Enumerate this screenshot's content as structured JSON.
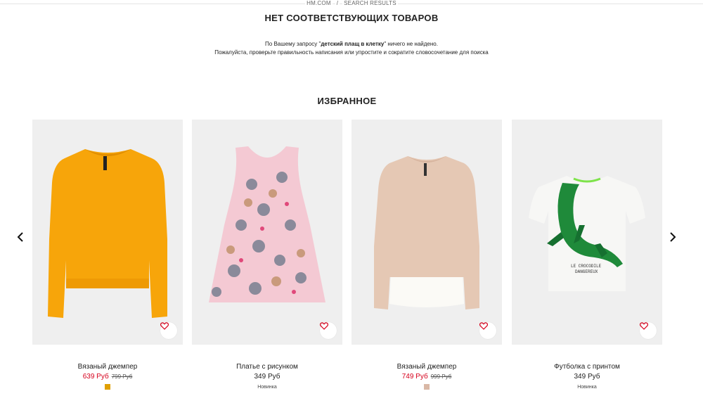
{
  "breadcrumb": {
    "home": "HM.COM",
    "separator": "/",
    "current": "SEARCH RESULTS"
  },
  "page_title": "НЕТ СООТВЕТСТВУЮЩИХ ТОВАРОВ",
  "message": {
    "prefix": "По Вашему запросу \"",
    "query": "детский плащ в клетку",
    "suffix": "\" ничего не найдено.",
    "line2": "Пожалуйста, проверьте правильность написания или упростите и сократите словосочетание для поиска"
  },
  "favorites_title": "ИЗБРАННОЕ",
  "icons": {
    "prev": "chevron-left-icon",
    "next": "chevron-right-icon",
    "favorite": "heart-icon"
  },
  "products": [
    {
      "name": "Вязаный джемпер",
      "price": "639 Руб",
      "old_price": "799 Руб",
      "on_sale": true,
      "swatch_color": "#e0a000",
      "badge": ""
    },
    {
      "name": "Платье с рисунком",
      "price": "349 Руб",
      "old_price": "",
      "on_sale": false,
      "swatch_color": "",
      "badge": "Новинка"
    },
    {
      "name": "Вязаный джемпер",
      "price": "749 Руб",
      "old_price": "999 Руб",
      "on_sale": true,
      "swatch_color": "#d9b8a6",
      "badge": ""
    },
    {
      "name": "Футболка с принтом",
      "price": "349 Руб",
      "old_price": "",
      "on_sale": false,
      "swatch_color": "",
      "badge": "Новинка"
    }
  ],
  "colors": {
    "sale": "#d6001c",
    "accent_orange": "#f7a50a",
    "pink_dress": "#f4c9d3",
    "beige": "#e5c8b4",
    "croc_green": "#1f8a3a"
  }
}
